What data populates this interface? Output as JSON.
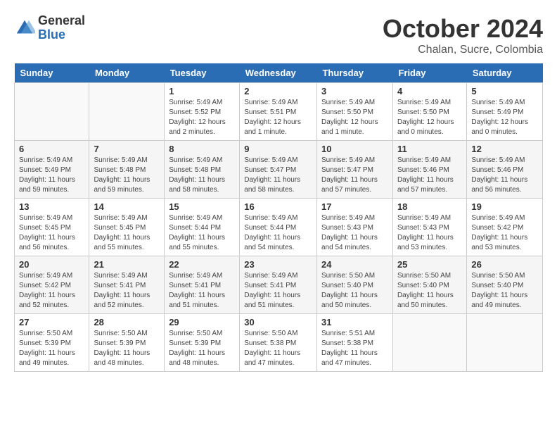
{
  "header": {
    "logo": {
      "general": "General",
      "blue": "Blue"
    },
    "title": "October 2024",
    "location": "Chalan, Sucre, Colombia"
  },
  "calendar": {
    "days_of_week": [
      "Sunday",
      "Monday",
      "Tuesday",
      "Wednesday",
      "Thursday",
      "Friday",
      "Saturday"
    ],
    "weeks": [
      [
        {
          "day": "",
          "sunrise": "",
          "sunset": "",
          "daylight": ""
        },
        {
          "day": "",
          "sunrise": "",
          "sunset": "",
          "daylight": ""
        },
        {
          "day": "1",
          "sunrise": "Sunrise: 5:49 AM",
          "sunset": "Sunset: 5:52 PM",
          "daylight": "Daylight: 12 hours and 2 minutes."
        },
        {
          "day": "2",
          "sunrise": "Sunrise: 5:49 AM",
          "sunset": "Sunset: 5:51 PM",
          "daylight": "Daylight: 12 hours and 1 minute."
        },
        {
          "day": "3",
          "sunrise": "Sunrise: 5:49 AM",
          "sunset": "Sunset: 5:50 PM",
          "daylight": "Daylight: 12 hours and 1 minute."
        },
        {
          "day": "4",
          "sunrise": "Sunrise: 5:49 AM",
          "sunset": "Sunset: 5:50 PM",
          "daylight": "Daylight: 12 hours and 0 minutes."
        },
        {
          "day": "5",
          "sunrise": "Sunrise: 5:49 AM",
          "sunset": "Sunset: 5:49 PM",
          "daylight": "Daylight: 12 hours and 0 minutes."
        }
      ],
      [
        {
          "day": "6",
          "sunrise": "Sunrise: 5:49 AM",
          "sunset": "Sunset: 5:49 PM",
          "daylight": "Daylight: 11 hours and 59 minutes."
        },
        {
          "day": "7",
          "sunrise": "Sunrise: 5:49 AM",
          "sunset": "Sunset: 5:48 PM",
          "daylight": "Daylight: 11 hours and 59 minutes."
        },
        {
          "day": "8",
          "sunrise": "Sunrise: 5:49 AM",
          "sunset": "Sunset: 5:48 PM",
          "daylight": "Daylight: 11 hours and 58 minutes."
        },
        {
          "day": "9",
          "sunrise": "Sunrise: 5:49 AM",
          "sunset": "Sunset: 5:47 PM",
          "daylight": "Daylight: 11 hours and 58 minutes."
        },
        {
          "day": "10",
          "sunrise": "Sunrise: 5:49 AM",
          "sunset": "Sunset: 5:47 PM",
          "daylight": "Daylight: 11 hours and 57 minutes."
        },
        {
          "day": "11",
          "sunrise": "Sunrise: 5:49 AM",
          "sunset": "Sunset: 5:46 PM",
          "daylight": "Daylight: 11 hours and 57 minutes."
        },
        {
          "day": "12",
          "sunrise": "Sunrise: 5:49 AM",
          "sunset": "Sunset: 5:46 PM",
          "daylight": "Daylight: 11 hours and 56 minutes."
        }
      ],
      [
        {
          "day": "13",
          "sunrise": "Sunrise: 5:49 AM",
          "sunset": "Sunset: 5:45 PM",
          "daylight": "Daylight: 11 hours and 56 minutes."
        },
        {
          "day": "14",
          "sunrise": "Sunrise: 5:49 AM",
          "sunset": "Sunset: 5:45 PM",
          "daylight": "Daylight: 11 hours and 55 minutes."
        },
        {
          "day": "15",
          "sunrise": "Sunrise: 5:49 AM",
          "sunset": "Sunset: 5:44 PM",
          "daylight": "Daylight: 11 hours and 55 minutes."
        },
        {
          "day": "16",
          "sunrise": "Sunrise: 5:49 AM",
          "sunset": "Sunset: 5:44 PM",
          "daylight": "Daylight: 11 hours and 54 minutes."
        },
        {
          "day": "17",
          "sunrise": "Sunrise: 5:49 AM",
          "sunset": "Sunset: 5:43 PM",
          "daylight": "Daylight: 11 hours and 54 minutes."
        },
        {
          "day": "18",
          "sunrise": "Sunrise: 5:49 AM",
          "sunset": "Sunset: 5:43 PM",
          "daylight": "Daylight: 11 hours and 53 minutes."
        },
        {
          "day": "19",
          "sunrise": "Sunrise: 5:49 AM",
          "sunset": "Sunset: 5:42 PM",
          "daylight": "Daylight: 11 hours and 53 minutes."
        }
      ],
      [
        {
          "day": "20",
          "sunrise": "Sunrise: 5:49 AM",
          "sunset": "Sunset: 5:42 PM",
          "daylight": "Daylight: 11 hours and 52 minutes."
        },
        {
          "day": "21",
          "sunrise": "Sunrise: 5:49 AM",
          "sunset": "Sunset: 5:41 PM",
          "daylight": "Daylight: 11 hours and 52 minutes."
        },
        {
          "day": "22",
          "sunrise": "Sunrise: 5:49 AM",
          "sunset": "Sunset: 5:41 PM",
          "daylight": "Daylight: 11 hours and 51 minutes."
        },
        {
          "day": "23",
          "sunrise": "Sunrise: 5:49 AM",
          "sunset": "Sunset: 5:41 PM",
          "daylight": "Daylight: 11 hours and 51 minutes."
        },
        {
          "day": "24",
          "sunrise": "Sunrise: 5:50 AM",
          "sunset": "Sunset: 5:40 PM",
          "daylight": "Daylight: 11 hours and 50 minutes."
        },
        {
          "day": "25",
          "sunrise": "Sunrise: 5:50 AM",
          "sunset": "Sunset: 5:40 PM",
          "daylight": "Daylight: 11 hours and 50 minutes."
        },
        {
          "day": "26",
          "sunrise": "Sunrise: 5:50 AM",
          "sunset": "Sunset: 5:40 PM",
          "daylight": "Daylight: 11 hours and 49 minutes."
        }
      ],
      [
        {
          "day": "27",
          "sunrise": "Sunrise: 5:50 AM",
          "sunset": "Sunset: 5:39 PM",
          "daylight": "Daylight: 11 hours and 49 minutes."
        },
        {
          "day": "28",
          "sunrise": "Sunrise: 5:50 AM",
          "sunset": "Sunset: 5:39 PM",
          "daylight": "Daylight: 11 hours and 48 minutes."
        },
        {
          "day": "29",
          "sunrise": "Sunrise: 5:50 AM",
          "sunset": "Sunset: 5:39 PM",
          "daylight": "Daylight: 11 hours and 48 minutes."
        },
        {
          "day": "30",
          "sunrise": "Sunrise: 5:50 AM",
          "sunset": "Sunset: 5:38 PM",
          "daylight": "Daylight: 11 hours and 47 minutes."
        },
        {
          "day": "31",
          "sunrise": "Sunrise: 5:51 AM",
          "sunset": "Sunset: 5:38 PM",
          "daylight": "Daylight: 11 hours and 47 minutes."
        },
        {
          "day": "",
          "sunrise": "",
          "sunset": "",
          "daylight": ""
        },
        {
          "day": "",
          "sunrise": "",
          "sunset": "",
          "daylight": ""
        }
      ]
    ]
  }
}
